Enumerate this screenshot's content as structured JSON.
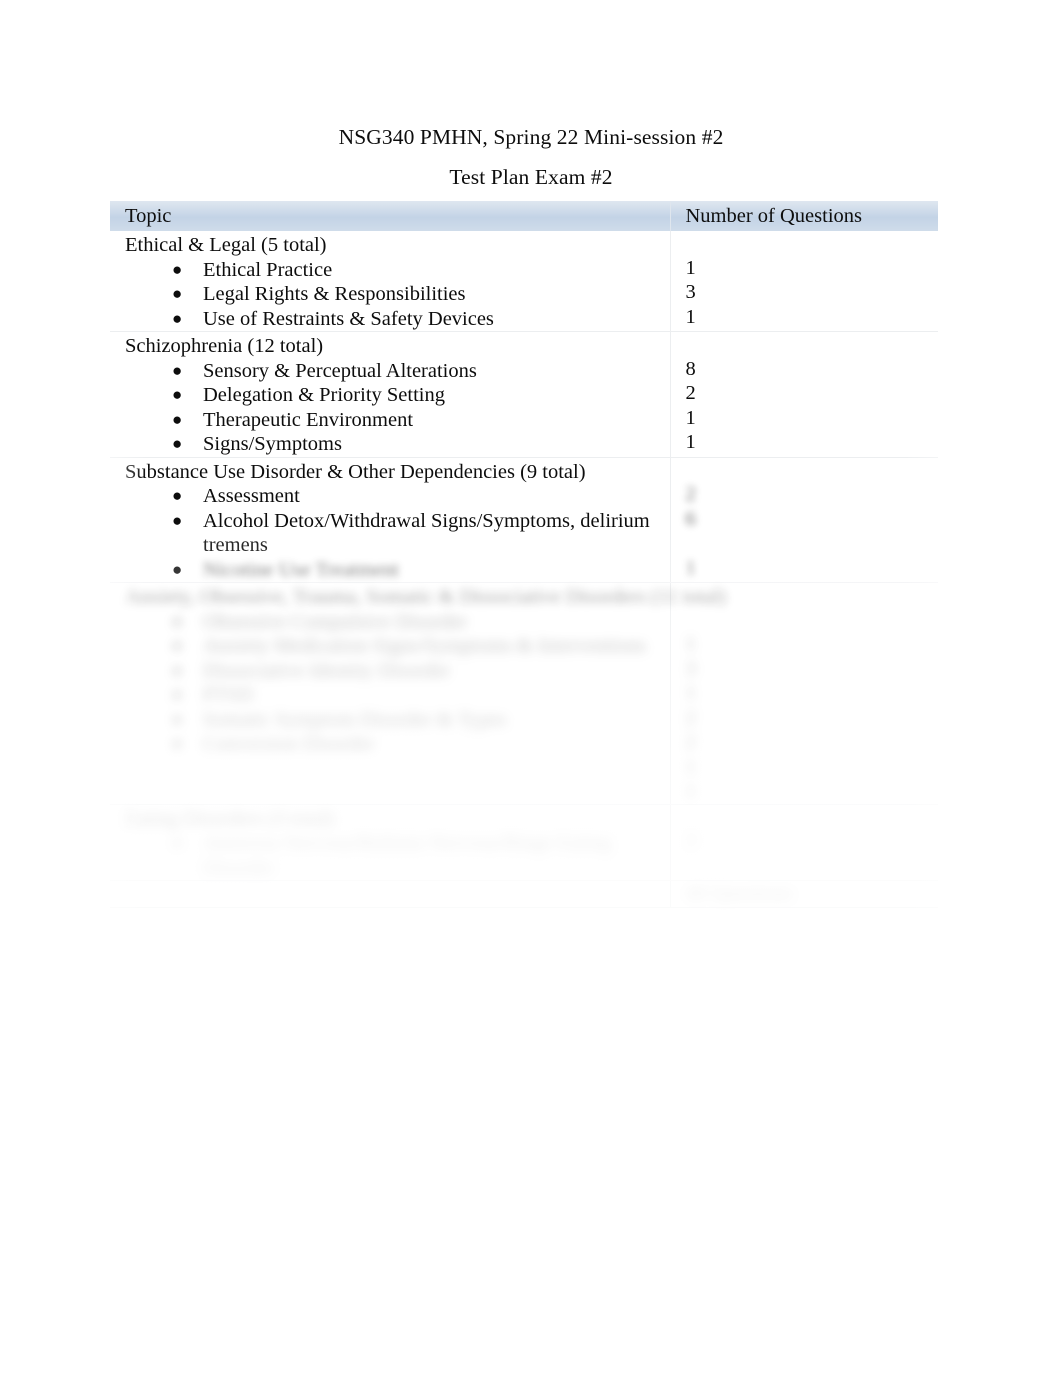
{
  "document": {
    "title": "NSG340 PMHN, Spring 22 Mini-session #2",
    "subtitle": "Test Plan Exam #2"
  },
  "table": {
    "headers": {
      "topic": "Topic",
      "count": "Number of Questions"
    },
    "sections": [
      {
        "id": "ethical-legal",
        "title": "Ethical & Legal (5 total)",
        "legible": true,
        "items": [
          {
            "label": "Ethical Practice",
            "count": "1"
          },
          {
            "label": "Legal Rights & Responsibilities",
            "count": "3"
          },
          {
            "label": "Use of Restraints & Safety Devices",
            "count": "1"
          }
        ]
      },
      {
        "id": "schizophrenia",
        "title": "Schizophrenia (12 total)",
        "legible": true,
        "items": [
          {
            "label": "Sensory & Perceptual Alterations",
            "count": "8"
          },
          {
            "label": "Delegation & Priority Setting",
            "count": "2"
          },
          {
            "label": "Therapeutic Environment",
            "count": "1"
          },
          {
            "label": "Signs/Symptoms",
            "count": "1"
          }
        ]
      },
      {
        "id": "substance-use-disorder",
        "title": "Substance Use Disorder & Other Dependencies (9 total)",
        "legible": true,
        "items": [
          {
            "label": "Assessment",
            "count": ""
          },
          {
            "label": "Alcohol Detox/Withdrawal Signs/Symptoms, delirium tremens",
            "count": ""
          },
          {
            "label": "",
            "count": "",
            "obscured": true
          }
        ]
      },
      {
        "id": "obscured-section-1",
        "title": "",
        "legible": false,
        "blur": "blur-3",
        "items": [
          {
            "label": "",
            "count": ""
          },
          {
            "label": "",
            "count": ""
          },
          {
            "label": "",
            "count": ""
          },
          {
            "label": "",
            "count": ""
          },
          {
            "label": "",
            "count": ""
          },
          {
            "label": "",
            "count": ""
          }
        ]
      },
      {
        "id": "obscured-section-2",
        "title": "",
        "legible": false,
        "blur": "blur-5",
        "items": [
          {
            "label": "",
            "count": ""
          }
        ]
      }
    ],
    "total": {
      "label": "",
      "value": "",
      "legible": false
    }
  },
  "notes": {
    "obscured_region": "Lower portion of the table is blurred in the source screenshot and is not machine-readable."
  }
}
